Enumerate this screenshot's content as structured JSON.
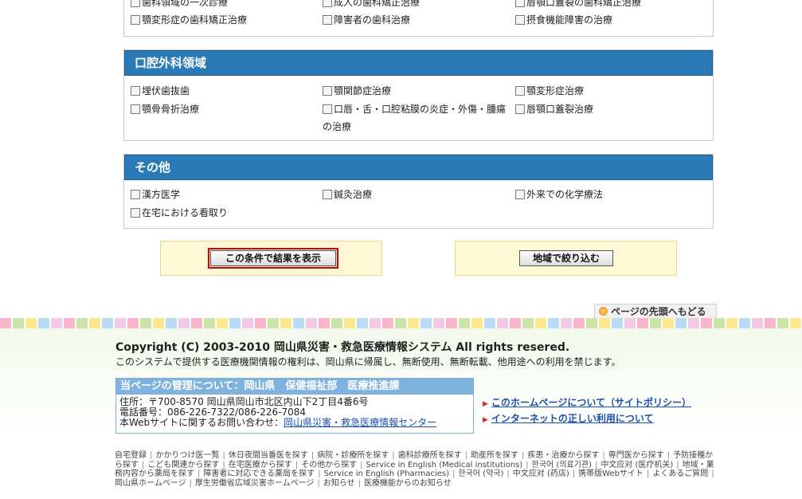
{
  "section_top_partial": {
    "rows": [
      [
        "歯科領域の一次診療",
        "成人の歯科矯正治療",
        "唇顎口蓋裂の歯科矯正治療"
      ],
      [
        "顎変形症の歯科矯正治療",
        "障害者の歯科治療",
        "摂食機能障害の治療"
      ]
    ]
  },
  "oral_surgery": {
    "title": "口腔外科領域",
    "items": [
      "埋伏歯抜歯",
      "顎関節症治療",
      "顎変形症治療",
      "顎骨骨折治療",
      "口唇・舌・口腔粘膜の炎症・外傷・腫瘍の治療",
      "唇顎口蓋裂治療"
    ]
  },
  "other": {
    "title": "その他",
    "items": [
      "漢方医学",
      "鍼灸治療",
      "外来での化学療法",
      "在宅における看取り"
    ]
  },
  "buttons": {
    "show_results": "この条件で結果を表示",
    "narrow_region": "地域で絞り込む"
  },
  "go_top": "ページの先頭へもどる",
  "footer": {
    "copyright": "Copyright (C) 2003-2010 岡山県災害・救急医療情報システム All rights resered.",
    "notice": "このシステムで提供する医療機関情報の権利は、岡山県に帰属し、無断使用、無断転載、他用途への利用を禁じます。",
    "admin_title": "当ページの管理について：岡山県　保健福祉部　医療推進課",
    "address": "住所：〒700-8570 岡山県岡山市北区内山下2丁目4番6号",
    "phone": "電話番号：086-226-7322/086-226-7084",
    "inquiry_label": "本Webサイトに関するお問い合わせ：",
    "inquiry_link": "岡山県災害・救急医療情報センター",
    "policy_link": "このホームページについて（サイトポリシー）",
    "internet_link": "インターネットの正しい利用について",
    "nav_links": [
      "自宅登録",
      "かかりつけ医一覧",
      "休日夜間当番医を探す",
      "病院・診療所を探す",
      "歯科診療所を探す",
      "助産所を探す",
      "疾患・治療から探す",
      "専門医から探す",
      "予防接種から探す",
      "こども関連から探す",
      "在宅医療から探す",
      "その他から探す",
      "Service in English (Medical institutions)",
      "한국어 (의료기관)",
      "中文应对 (医疗机关)",
      "地域・業務内容から薬局を探す",
      "障害者に対応できる薬局を探す",
      "Service in English (Pharmacies)",
      "한국어 (약국)",
      "中文应对 (药店)",
      "携帯版Webサイト",
      "よくあるご質問",
      "岡山県ホームページ",
      "厚生労働省広域災害ホームページ",
      "お知らせ",
      "医療機能からのお知らせ"
    ]
  }
}
